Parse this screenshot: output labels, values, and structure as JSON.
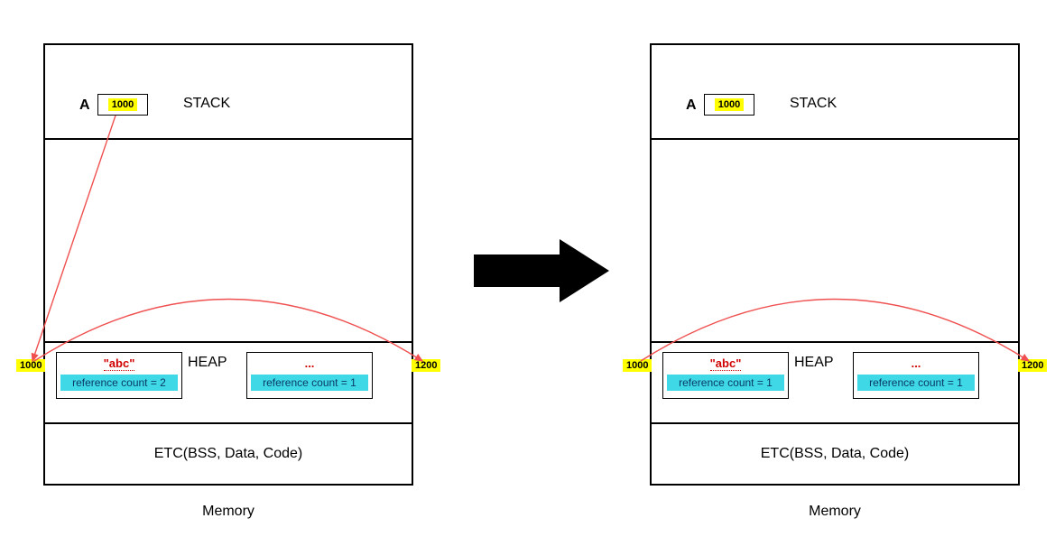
{
  "diagram": {
    "left": {
      "stack": {
        "var_label": "A",
        "var_value": "1000",
        "section_label": "STACK"
      },
      "heap": {
        "section_label": "HEAP",
        "addr_left": "1000",
        "addr_right": "1200",
        "objects": [
          {
            "value": "\"abc\"",
            "refcount_label": "reference count = 2"
          },
          {
            "value": "...",
            "refcount_label": "reference count = 1"
          }
        ]
      },
      "etc_label": "ETC(BSS, Data, Code)",
      "caption": "Memory"
    },
    "right": {
      "stack": {
        "var_label": "A",
        "var_value": "1000",
        "section_label": "STACK"
      },
      "heap": {
        "section_label": "HEAP",
        "addr_left": "1000",
        "addr_right": "1200",
        "objects": [
          {
            "value": "\"abc\"",
            "refcount_label": "reference count = 1"
          },
          {
            "value": "...",
            "refcount_label": "reference count = 1"
          }
        ]
      },
      "etc_label": "ETC(BSS, Data, Code)",
      "caption": "Memory"
    }
  }
}
